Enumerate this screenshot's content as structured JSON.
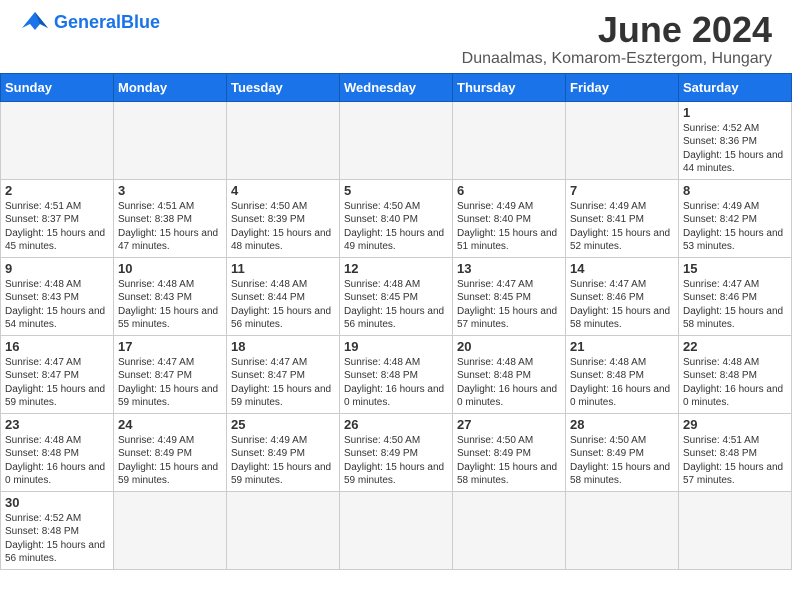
{
  "header": {
    "logo_text_general": "General",
    "logo_text_blue": "Blue",
    "month_year": "June 2024",
    "location": "Dunaalmas, Komarom-Esztergom, Hungary"
  },
  "days_of_week": [
    "Sunday",
    "Monday",
    "Tuesday",
    "Wednesday",
    "Thursday",
    "Friday",
    "Saturday"
  ],
  "weeks": [
    {
      "days": [
        {
          "number": "",
          "empty": true
        },
        {
          "number": "",
          "empty": true
        },
        {
          "number": "",
          "empty": true
        },
        {
          "number": "",
          "empty": true
        },
        {
          "number": "",
          "empty": true
        },
        {
          "number": "",
          "empty": true
        },
        {
          "number": "1",
          "sunrise": "Sunrise: 4:52 AM",
          "sunset": "Sunset: 8:36 PM",
          "daylight": "Daylight: 15 hours and 44 minutes."
        }
      ]
    },
    {
      "days": [
        {
          "number": "2",
          "sunrise": "Sunrise: 4:51 AM",
          "sunset": "Sunset: 8:37 PM",
          "daylight": "Daylight: 15 hours and 45 minutes."
        },
        {
          "number": "3",
          "sunrise": "Sunrise: 4:51 AM",
          "sunset": "Sunset: 8:38 PM",
          "daylight": "Daylight: 15 hours and 47 minutes."
        },
        {
          "number": "4",
          "sunrise": "Sunrise: 4:50 AM",
          "sunset": "Sunset: 8:39 PM",
          "daylight": "Daylight: 15 hours and 48 minutes."
        },
        {
          "number": "5",
          "sunrise": "Sunrise: 4:50 AM",
          "sunset": "Sunset: 8:40 PM",
          "daylight": "Daylight: 15 hours and 49 minutes."
        },
        {
          "number": "6",
          "sunrise": "Sunrise: 4:49 AM",
          "sunset": "Sunset: 8:40 PM",
          "daylight": "Daylight: 15 hours and 51 minutes."
        },
        {
          "number": "7",
          "sunrise": "Sunrise: 4:49 AM",
          "sunset": "Sunset: 8:41 PM",
          "daylight": "Daylight: 15 hours and 52 minutes."
        },
        {
          "number": "8",
          "sunrise": "Sunrise: 4:49 AM",
          "sunset": "Sunset: 8:42 PM",
          "daylight": "Daylight: 15 hours and 53 minutes."
        }
      ]
    },
    {
      "days": [
        {
          "number": "9",
          "sunrise": "Sunrise: 4:48 AM",
          "sunset": "Sunset: 8:43 PM",
          "daylight": "Daylight: 15 hours and 54 minutes."
        },
        {
          "number": "10",
          "sunrise": "Sunrise: 4:48 AM",
          "sunset": "Sunset: 8:43 PM",
          "daylight": "Daylight: 15 hours and 55 minutes."
        },
        {
          "number": "11",
          "sunrise": "Sunrise: 4:48 AM",
          "sunset": "Sunset: 8:44 PM",
          "daylight": "Daylight: 15 hours and 56 minutes."
        },
        {
          "number": "12",
          "sunrise": "Sunrise: 4:48 AM",
          "sunset": "Sunset: 8:45 PM",
          "daylight": "Daylight: 15 hours and 56 minutes."
        },
        {
          "number": "13",
          "sunrise": "Sunrise: 4:47 AM",
          "sunset": "Sunset: 8:45 PM",
          "daylight": "Daylight: 15 hours and 57 minutes."
        },
        {
          "number": "14",
          "sunrise": "Sunrise: 4:47 AM",
          "sunset": "Sunset: 8:46 PM",
          "daylight": "Daylight: 15 hours and 58 minutes."
        },
        {
          "number": "15",
          "sunrise": "Sunrise: 4:47 AM",
          "sunset": "Sunset: 8:46 PM",
          "daylight": "Daylight: 15 hours and 58 minutes."
        }
      ]
    },
    {
      "days": [
        {
          "number": "16",
          "sunrise": "Sunrise: 4:47 AM",
          "sunset": "Sunset: 8:47 PM",
          "daylight": "Daylight: 15 hours and 59 minutes."
        },
        {
          "number": "17",
          "sunrise": "Sunrise: 4:47 AM",
          "sunset": "Sunset: 8:47 PM",
          "daylight": "Daylight: 15 hours and 59 minutes."
        },
        {
          "number": "18",
          "sunrise": "Sunrise: 4:47 AM",
          "sunset": "Sunset: 8:47 PM",
          "daylight": "Daylight: 15 hours and 59 minutes."
        },
        {
          "number": "19",
          "sunrise": "Sunrise: 4:48 AM",
          "sunset": "Sunset: 8:48 PM",
          "daylight": "Daylight: 16 hours and 0 minutes."
        },
        {
          "number": "20",
          "sunrise": "Sunrise: 4:48 AM",
          "sunset": "Sunset: 8:48 PM",
          "daylight": "Daylight: 16 hours and 0 minutes."
        },
        {
          "number": "21",
          "sunrise": "Sunrise: 4:48 AM",
          "sunset": "Sunset: 8:48 PM",
          "daylight": "Daylight: 16 hours and 0 minutes."
        },
        {
          "number": "22",
          "sunrise": "Sunrise: 4:48 AM",
          "sunset": "Sunset: 8:48 PM",
          "daylight": "Daylight: 16 hours and 0 minutes."
        }
      ]
    },
    {
      "days": [
        {
          "number": "23",
          "sunrise": "Sunrise: 4:48 AM",
          "sunset": "Sunset: 8:48 PM",
          "daylight": "Daylight: 16 hours and 0 minutes."
        },
        {
          "number": "24",
          "sunrise": "Sunrise: 4:49 AM",
          "sunset": "Sunset: 8:49 PM",
          "daylight": "Daylight: 15 hours and 59 minutes."
        },
        {
          "number": "25",
          "sunrise": "Sunrise: 4:49 AM",
          "sunset": "Sunset: 8:49 PM",
          "daylight": "Daylight: 15 hours and 59 minutes."
        },
        {
          "number": "26",
          "sunrise": "Sunrise: 4:50 AM",
          "sunset": "Sunset: 8:49 PM",
          "daylight": "Daylight: 15 hours and 59 minutes."
        },
        {
          "number": "27",
          "sunrise": "Sunrise: 4:50 AM",
          "sunset": "Sunset: 8:49 PM",
          "daylight": "Daylight: 15 hours and 58 minutes."
        },
        {
          "number": "28",
          "sunrise": "Sunrise: 4:50 AM",
          "sunset": "Sunset: 8:49 PM",
          "daylight": "Daylight: 15 hours and 58 minutes."
        },
        {
          "number": "29",
          "sunrise": "Sunrise: 4:51 AM",
          "sunset": "Sunset: 8:48 PM",
          "daylight": "Daylight: 15 hours and 57 minutes."
        }
      ]
    },
    {
      "days": [
        {
          "number": "30",
          "sunrise": "Sunrise: 4:52 AM",
          "sunset": "Sunset: 8:48 PM",
          "daylight": "Daylight: 15 hours and 56 minutes."
        },
        {
          "number": "",
          "empty": true
        },
        {
          "number": "",
          "empty": true
        },
        {
          "number": "",
          "empty": true
        },
        {
          "number": "",
          "empty": true
        },
        {
          "number": "",
          "empty": true
        },
        {
          "number": "",
          "empty": true
        }
      ]
    }
  ]
}
